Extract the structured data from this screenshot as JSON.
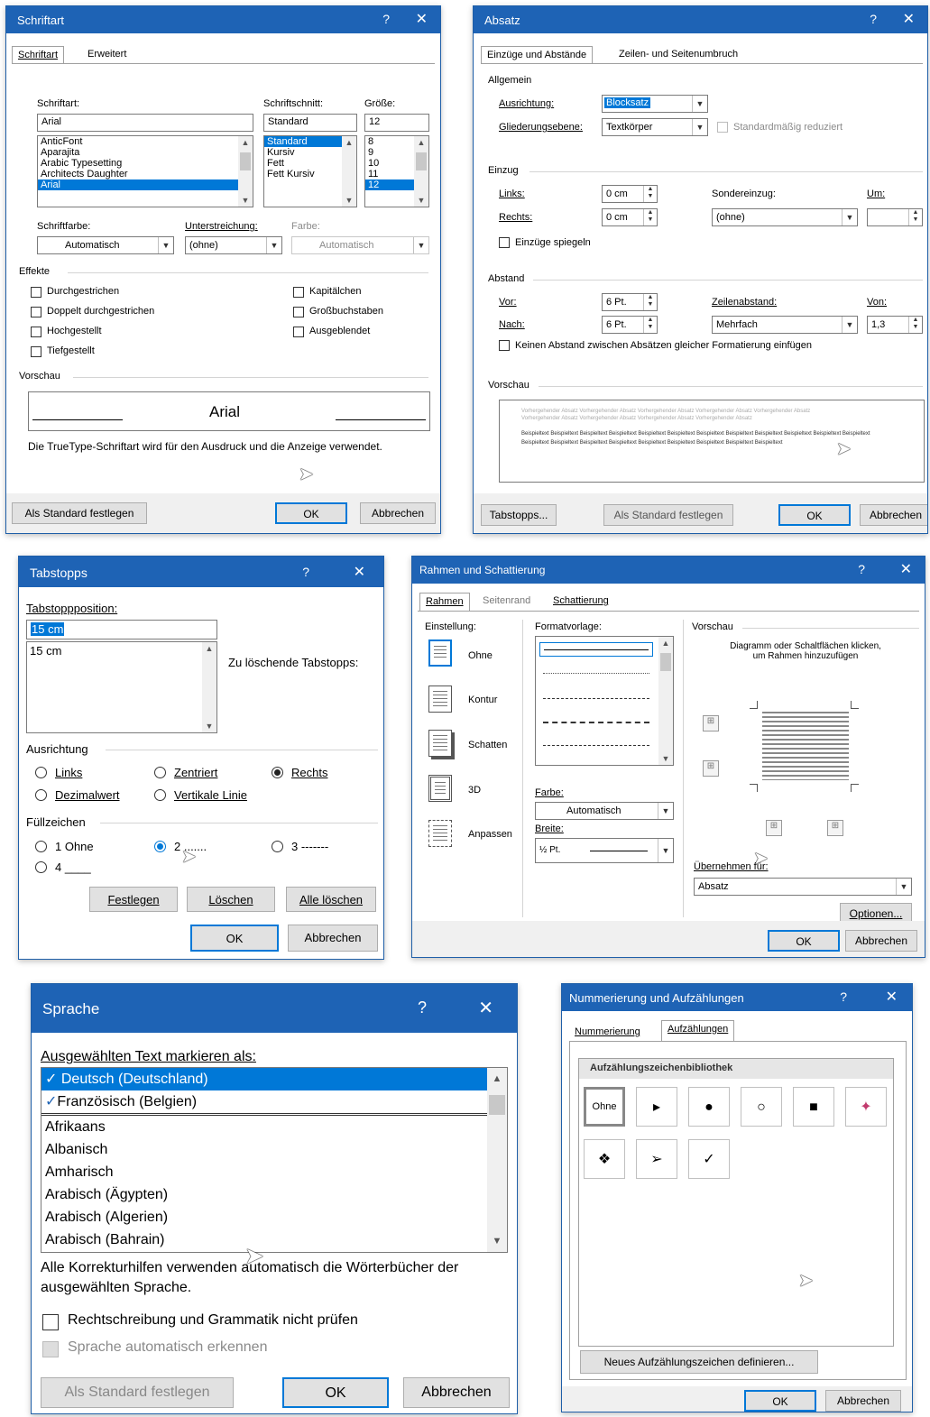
{
  "schriftart": {
    "title": "Schriftart",
    "help": "?",
    "close": "✕",
    "tabs": [
      "Schriftart",
      "Erweitert"
    ],
    "font_label": "Schriftart:",
    "font_value": "Arial",
    "font_list": [
      "AnticFont",
      "Aparajita",
      "Arabic Typesetting",
      "Architects Daughter",
      "Arial"
    ],
    "style_label": "Schriftschnitt:",
    "style_value": "Standard",
    "style_list": [
      "Standard",
      "Kursiv",
      "Fett",
      "Fett Kursiv"
    ],
    "size_label": "Größe:",
    "size_value": "12",
    "size_list": [
      "8",
      "9",
      "10",
      "11",
      "12"
    ],
    "color_label": "Schriftfarbe:",
    "color_value": "Automatisch",
    "underline_label": "Unterstreichung:",
    "underline_value": "(ohne)",
    "ucolor_label": "Farbe:",
    "ucolor_value": "Automatisch",
    "effects_label": "Effekte",
    "effects_left": [
      "Durchgestrichen",
      "Doppelt durchgestrichen",
      "Hochgestellt",
      "Tiefgestellt"
    ],
    "effects_right": [
      "Kapitälchen",
      "Großbuchstaben",
      "Ausgeblendet"
    ],
    "preview_label": "Vorschau",
    "preview_text": "Arial",
    "info": "Die TrueType-Schriftart wird für den Ausdruck und die Anzeige verwendet.",
    "default_btn": "Als Standard festlegen",
    "ok": "OK",
    "cancel": "Abbrechen"
  },
  "absatz": {
    "title": "Absatz",
    "help": "?",
    "close": "✕",
    "tabs": [
      "Einzüge und Abstände",
      "Zeilen- und Seitenumbruch"
    ],
    "general": "Allgemein",
    "align_label": "Ausrichtung:",
    "align_value": "Blocksatz",
    "outline_label": "Gliederungsebene:",
    "outline_value": "Textkörper",
    "collapsed_label": "Standardmäßig reduziert",
    "indent": "Einzug",
    "left_label": "Links:",
    "left_value": "0 cm",
    "right_label": "Rechts:",
    "right_value": "0 cm",
    "special_label": "Sondereinzug:",
    "special_value": "(ohne)",
    "by_label": "Um:",
    "mirror_label": "Einzüge spiegeln",
    "spacing": "Abstand",
    "before_label": "Vor:",
    "before_value": "6 Pt.",
    "after_label": "Nach:",
    "after_value": "6 Pt.",
    "line_label": "Zeilenabstand:",
    "line_value": "Mehrfach",
    "at_label": "Von:",
    "at_value": "1,3",
    "nospace_label": "Keinen Abstand zwischen Absätzen gleicher Formatierung einfügen",
    "preview_label": "Vorschau",
    "preview_prev": "Vorhergehender Absatz Vorhergehender Absatz Vorhergehender Absatz Vorhergehender Absatz Vorhergehender Absatz Vorhergehender Absatz Vorhergehender Absatz Vorhergehender Absatz Vorhergehender Absatz",
    "preview_sample": "Beispieltext Beispieltext Beispieltext Beispieltext Beispieltext Beispieltext Beispieltext Beispieltext Beispieltext Beispieltext Beispieltext Beispieltext Beispieltext Beispieltext Beispieltext Beispieltext Beispieltext Beispieltext Beispieltext Beispieltext Beispieltext",
    "tabs_btn": "Tabstopps...",
    "default_btn": "Als Standard festlegen",
    "ok": "OK",
    "cancel": "Abbrechen"
  },
  "tabstopps": {
    "title": "Tabstopps",
    "help": "?",
    "close": "✕",
    "pos_label": "Tabstoppposition:",
    "pos_value": "15 cm",
    "list": [
      "15 cm"
    ],
    "clear_label": "Zu löschende Tabstopps:",
    "align_label": "Ausrichtung",
    "align_opts": [
      "Links",
      "Zentriert",
      "Rechts",
      "Dezimalwert",
      "Vertikale Linie"
    ],
    "leader_label": "Füllzeichen",
    "leader_opts": [
      "1 Ohne",
      "2 .......",
      "3 -------",
      "4 ____"
    ],
    "set_btn": "Festlegen",
    "clear_btn": "Löschen",
    "clearall_btn": "Alle löschen",
    "ok": "OK",
    "cancel": "Abbrechen"
  },
  "rahmen": {
    "title": "Rahmen und Schattierung",
    "help": "?",
    "close": "✕",
    "tabs": [
      "Rahmen",
      "Seitenrand",
      "Schattierung"
    ],
    "setting_label": "Einstellung:",
    "settings": [
      "Ohne",
      "Kontur",
      "Schatten",
      "3D",
      "Anpassen"
    ],
    "style_label": "Formatvorlage:",
    "color_label": "Farbe:",
    "color_value": "Automatisch",
    "width_label": "Breite:",
    "width_value": "½ Pt.",
    "preview_label": "Vorschau",
    "preview_hint": "Diagramm oder Schaltflächen klicken, um Rahmen hinzuzufügen",
    "apply_label": "Übernehmen für:",
    "apply_value": "Absatz",
    "options_btn": "Optionen...",
    "ok": "OK",
    "cancel": "Abbrechen"
  },
  "sprache": {
    "title": "Sprache",
    "help": "?",
    "close": "✕",
    "mark_label": "Ausgewählten Text markieren als:",
    "languages": [
      "Deutsch (Deutschland)",
      "Französisch (Belgien)",
      "Afrikaans",
      "Albanisch",
      "Amharisch",
      "Arabisch (Ägypten)",
      "Arabisch (Algerien)",
      "Arabisch (Bahrain)"
    ],
    "info": "Alle Korrekturhilfen verwenden automatisch die Wörterbücher der ausgewählten Sprache.",
    "nocheck_label": "Rechtschreibung und Grammatik nicht prüfen",
    "detect_label": "Sprache automatisch erkennen",
    "default_btn": "Als Standard festlegen",
    "ok": "OK",
    "cancel": "Abbrechen"
  },
  "nummerierung": {
    "title": "Nummerierung und Aufzählungen",
    "help": "?",
    "close": "✕",
    "tabs": [
      "Nummerierung",
      "Aufzählungen"
    ],
    "library_label": "Aufzählungszeichenbibliothek",
    "bullets": [
      "Ohne",
      "▸",
      "●",
      "○",
      "■",
      "✦",
      "❖",
      "➢",
      "✓"
    ],
    "define_btn": "Neues Aufzählungszeichen definieren...",
    "ok": "OK",
    "cancel": "Abbrechen"
  }
}
